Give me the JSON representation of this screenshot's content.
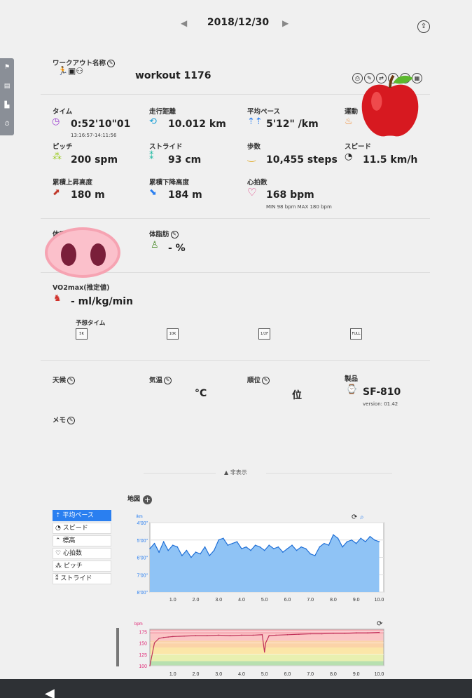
{
  "nav": {
    "prev": "◀",
    "next": "▶",
    "date": "2018/12/30",
    "share": "⇪"
  },
  "side_tabs": [
    "⚑",
    "▤",
    "▙",
    "⏱"
  ],
  "workout": {
    "name_label": "ワークアウト名称",
    "name_value": "workout 1176",
    "tool_icons": [
      "⎙",
      "✎",
      "⇄",
      "✓",
      "⚉",
      "▦"
    ]
  },
  "stats": {
    "time": {
      "label": "タイム",
      "value": "0:52'10\"01",
      "sub": "13:16:57-14:11:56"
    },
    "distance": {
      "label": "走行距離",
      "value": "10.012 km"
    },
    "pace": {
      "label": "平均ペース",
      "value": "5'12\" /km"
    },
    "exercise": {
      "label": "運動"
    },
    "pitch": {
      "label": "ピッチ",
      "value": "200 spm"
    },
    "stride": {
      "label": "ストライド",
      "value": "93 cm"
    },
    "steps": {
      "label": "歩数",
      "value": "10,455 steps"
    },
    "speed": {
      "label": "スピード",
      "value": "11.5 km/h"
    },
    "ascent": {
      "label": "累積上昇高度",
      "value": "180 m"
    },
    "descent": {
      "label": "累積下降高度",
      "value": "184 m"
    },
    "hr": {
      "label": "心拍数",
      "value": "168 bpm",
      "sub": "MIN 98 bpm MAX 180 bpm"
    }
  },
  "body": {
    "weight_label": "体重",
    "fat_label": "体脂肪",
    "fat_value": "- %",
    "vo2_label": "VO2max(推定値)",
    "vo2_value": "- ml/kg/min",
    "predict_label": "予想タイム",
    "predict_items": [
      "5K",
      "10K",
      "1/2F",
      "FULL"
    ]
  },
  "conditions": {
    "weather_label": "天候",
    "temp_label": "気温",
    "temp_unit": "°C",
    "rank_label": "順位",
    "rank_unit": "位",
    "product_label": "製品",
    "product_value": "SF-810",
    "product_version": "version: 01.42",
    "memo_label": "メモ"
  },
  "hide_label": "非表示",
  "map_label": "地図",
  "series_list": [
    "平均ペース",
    "スピード",
    "標高",
    "心拍数",
    "ピッチ",
    "ストライド"
  ],
  "chart_data": [
    {
      "type": "area",
      "ylabel": "/km",
      "x": [
        0,
        0.2,
        0.4,
        0.6,
        0.8,
        1.0,
        1.2,
        1.4,
        1.6,
        1.8,
        2.0,
        2.2,
        2.4,
        2.6,
        2.8,
        3.0,
        3.2,
        3.4,
        3.6,
        3.8,
        4.0,
        4.2,
        4.4,
        4.6,
        4.8,
        5.0,
        5.2,
        5.4,
        5.6,
        5.8,
        6.0,
        6.2,
        6.4,
        6.6,
        6.8,
        7.0,
        7.2,
        7.4,
        7.6,
        7.8,
        8.0,
        8.2,
        8.4,
        8.6,
        8.8,
        9.0,
        9.2,
        9.4,
        9.6,
        9.8,
        10.0
      ],
      "series": [
        {
          "values": [
            5.5,
            5.2,
            5.7,
            5.1,
            5.6,
            5.3,
            5.4,
            5.9,
            5.6,
            6.0,
            5.7,
            5.8,
            5.4,
            5.9,
            5.6,
            5.0,
            4.9,
            5.3,
            5.2,
            5.1,
            5.5,
            5.4,
            5.6,
            5.3,
            5.4,
            5.6,
            5.3,
            5.5,
            5.4,
            5.7,
            5.5,
            5.3,
            5.6,
            5.4,
            5.5,
            5.8,
            5.9,
            5.4,
            5.2,
            5.3,
            4.7,
            4.9,
            5.4,
            5.1,
            5.0,
            5.2,
            4.9,
            5.1,
            4.8,
            5.0,
            5.1
          ]
        }
      ],
      "yticks": [
        "4'00\"",
        "5'00\"",
        "6'00\"",
        "7'00\"",
        "8'00\""
      ],
      "ylim": [
        4,
        8
      ],
      "xticks": [
        "1.0",
        "2.0",
        "3.0",
        "4.0",
        "5.0",
        "6.0",
        "7.0",
        "8.0",
        "9.0",
        "10.0"
      ],
      "xlim": [
        0,
        10.2
      ]
    },
    {
      "type": "line",
      "ylabel": "bpm",
      "x": [
        0,
        0.2,
        0.4,
        0.6,
        0.8,
        1.0,
        1.5,
        2.0,
        2.5,
        3.0,
        3.5,
        4.0,
        4.5,
        4.9,
        5.0,
        5.05,
        5.2,
        5.5,
        6.0,
        6.5,
        7.0,
        7.5,
        8.0,
        8.5,
        9.0,
        9.5,
        10.0
      ],
      "series": [
        {
          "values": [
            100,
            150,
            160,
            162,
            163,
            164,
            165,
            166,
            166,
            167,
            166,
            167,
            167,
            168,
            130,
            150,
            166,
            167,
            168,
            169,
            170,
            170,
            171,
            171,
            172,
            172,
            173
          ]
        }
      ],
      "yticks": [
        "100",
        "125",
        "150",
        "175"
      ],
      "ylim": [
        100,
        180
      ],
      "xticks": [
        "1.0",
        "2.0",
        "3.0",
        "4.0",
        "5.0",
        "6.0",
        "7.0",
        "8.0",
        "9.0",
        "10.0"
      ],
      "xlim": [
        0,
        10.2
      ]
    }
  ]
}
